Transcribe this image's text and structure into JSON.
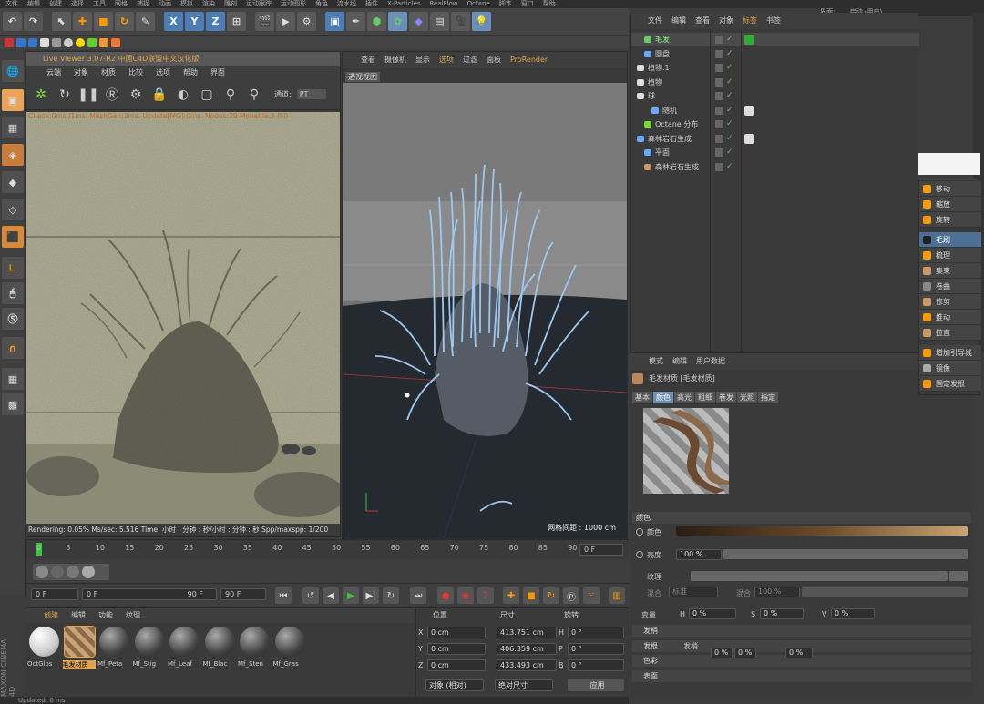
{
  "menu": [
    "文件",
    "编辑",
    "创建",
    "选择",
    "工具",
    "网格",
    "捕捉",
    "动画",
    "模拟",
    "渲染",
    "雕刻",
    "运动跟踪",
    "运动图形",
    "角色",
    "流水线",
    "插件",
    "X-Particles",
    "RealFlow",
    "Octane",
    "脚本",
    "窗口",
    "帮助"
  ],
  "layout_label": "界面:",
  "layout_value": "启动 (用户)",
  "toolbar": {
    "x": "X",
    "y": "Y",
    "z": "Z"
  },
  "live_viewer": {
    "title": "Live Viewer 3.07-R2 中国C4D联盟中文汉化版",
    "menu": [
      "云端",
      "对象",
      "材质",
      "比较",
      "选项",
      "帮助",
      "界面"
    ],
    "channel_label": "通道:",
    "channel_value": "PT",
    "stat_line": "Check:0ms./1ms. MeshGen:3ms. Update[MG]:0ms. Nodes:29 Movable:3  0 0",
    "status": "Rendering: 0.05%   Ms/sec: 5.516   Time: 小时 : 分钟 : 秒/小时 : 分钟 : 秒   Spp/maxspp: 1/200"
  },
  "viewport": {
    "menu": [
      "查看",
      "摄像机",
      "显示",
      "选项",
      "过滤",
      "面板",
      "ProRender"
    ],
    "label": "透视视图",
    "grid_distance": "网格间距 : 1000 cm"
  },
  "timeline": {
    "ticks": [
      "0",
      "5",
      "10",
      "15",
      "20",
      "25",
      "30",
      "35",
      "40",
      "45",
      "50",
      "55",
      "60",
      "65",
      "70",
      "75",
      "80",
      "85",
      "90"
    ],
    "frame_end": "0 F"
  },
  "transport": {
    "start": "0 F",
    "range_start": "0 F",
    "range_end": "90 F",
    "end": "90 F"
  },
  "material_panel": {
    "menu": [
      "创建",
      "编辑",
      "功能",
      "纹理"
    ],
    "materials": [
      "OctGlos",
      "毛发材质",
      "Mf_Peta",
      "Mf_Stig",
      "Mf_Leaf",
      "Mf_Blac",
      "Mf_Sten",
      "Mf_Gras"
    ]
  },
  "coords": {
    "headers": [
      "位置",
      "尺寸",
      "旋转"
    ],
    "rows": [
      {
        "axis": "X",
        "pos": "0 cm",
        "size": "413.751 cm",
        "rlabel": "H",
        "rot": "0 °"
      },
      {
        "axis": "Y",
        "pos": "0 cm",
        "size": "406.359 cm",
        "rlabel": "P",
        "rot": "0 °"
      },
      {
        "axis": "Z",
        "pos": "0 cm",
        "size": "433.493 cm",
        "rlabel": "B",
        "rot": "0 °"
      }
    ],
    "mode1": "对象 (相对)",
    "mode2": "绝对尺寸",
    "apply": "应用"
  },
  "status_bar": "Updated: 0 ms",
  "brand": "MAXON CINEMA 4D",
  "object_manager": {
    "menu": [
      "文件",
      "编辑",
      "查看",
      "对象",
      "标签",
      "书签"
    ],
    "objects": [
      "毛发",
      "圆盘",
      "植物.1",
      "植物",
      "球",
      "随机",
      "Octane 分布",
      "森林岩石生成",
      "平面",
      "森林岩石生成"
    ]
  },
  "attributes": {
    "menu": [
      "模式",
      "编辑",
      "用户数据"
    ],
    "title": "毛发材质 [毛发材质]",
    "tabs": [
      "基本",
      "颜色",
      "高光",
      "粗细",
      "卷发",
      "光照",
      "指定"
    ],
    "section": "颜色",
    "color_label": "颜色",
    "brightness_label": "亮度",
    "brightness_value": "100 %",
    "texture_label": "纹理",
    "mix_label": "混合",
    "mix_mode": "标准",
    "mix_label2": "混合",
    "mix_value": "100 %",
    "vary_label": "变量",
    "h": "H",
    "h_val": "0 %",
    "s": "S",
    "s_val": "0 %",
    "v": "V",
    "v_val": "0 %",
    "collapsed": [
      "发梢",
      "发根",
      "色彩",
      "表面"
    ],
    "sub_label": "发梢",
    "extra_vals": [
      "0 %",
      "0 %",
      "0 %"
    ]
  },
  "popup_menu": [
    "移动",
    "缩放",
    "旋转",
    "毛刷",
    "梳理",
    "集束",
    "卷曲",
    "修剪",
    "推动",
    "拉直",
    "增加引导线",
    "镜像",
    "固定发根"
  ],
  "popup_active": "毛刷",
  "colors": {
    "accent": "#4e6f95",
    "live_title": "#e0a24a",
    "hair": "#9cc8f0"
  }
}
